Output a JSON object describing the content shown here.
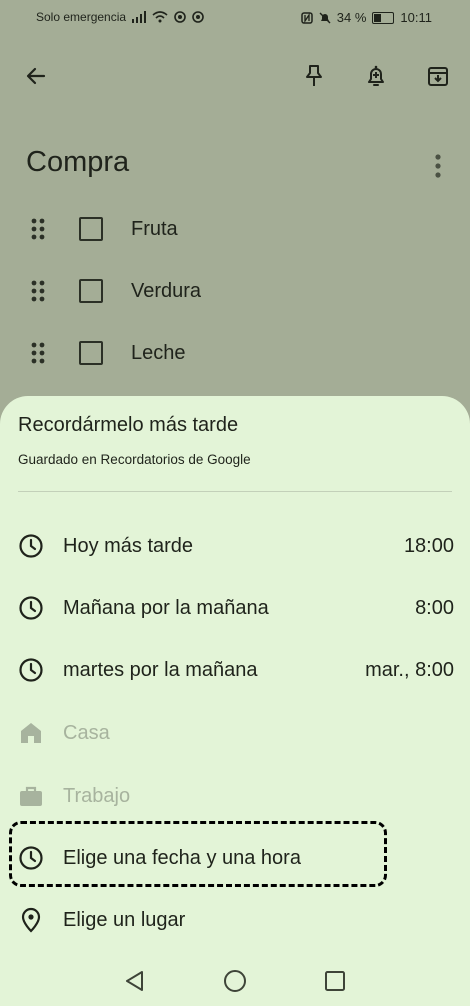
{
  "status": {
    "carrier": "Solo emergencia",
    "battery": "34 %",
    "time": "10:11"
  },
  "note": {
    "title": "Compra",
    "items": [
      {
        "label": "Fruta",
        "checked": false
      },
      {
        "label": "Verdura",
        "checked": false
      },
      {
        "label": "Leche",
        "checked": false
      }
    ]
  },
  "sheet": {
    "title": "Recordármelo más tarde",
    "subtitle": "Guardado en Recordatorios de Google",
    "options": [
      {
        "icon": "clock-icon",
        "label": "Hoy más tarde",
        "time": "18:00",
        "enabled": true
      },
      {
        "icon": "clock-icon",
        "label": "Mañana por la mañana",
        "time": "8:00",
        "enabled": true
      },
      {
        "icon": "clock-icon",
        "label": "martes por la mañana",
        "time": "mar., 8:00",
        "enabled": true
      },
      {
        "icon": "home-icon",
        "label": "Casa",
        "time": "",
        "enabled": false
      },
      {
        "icon": "briefcase-icon",
        "label": "Trabajo",
        "time": "",
        "enabled": false
      },
      {
        "icon": "clock-icon",
        "label": "Elige una fecha y una hora",
        "time": "",
        "enabled": true
      },
      {
        "icon": "location-pin-icon",
        "label": "Elige un lugar",
        "time": "",
        "enabled": true
      }
    ]
  },
  "colors": {
    "scrim": "#a4ad96",
    "sheet": "#e3f4d7",
    "text": "#1f231b",
    "disabled": "#a7b39e"
  }
}
